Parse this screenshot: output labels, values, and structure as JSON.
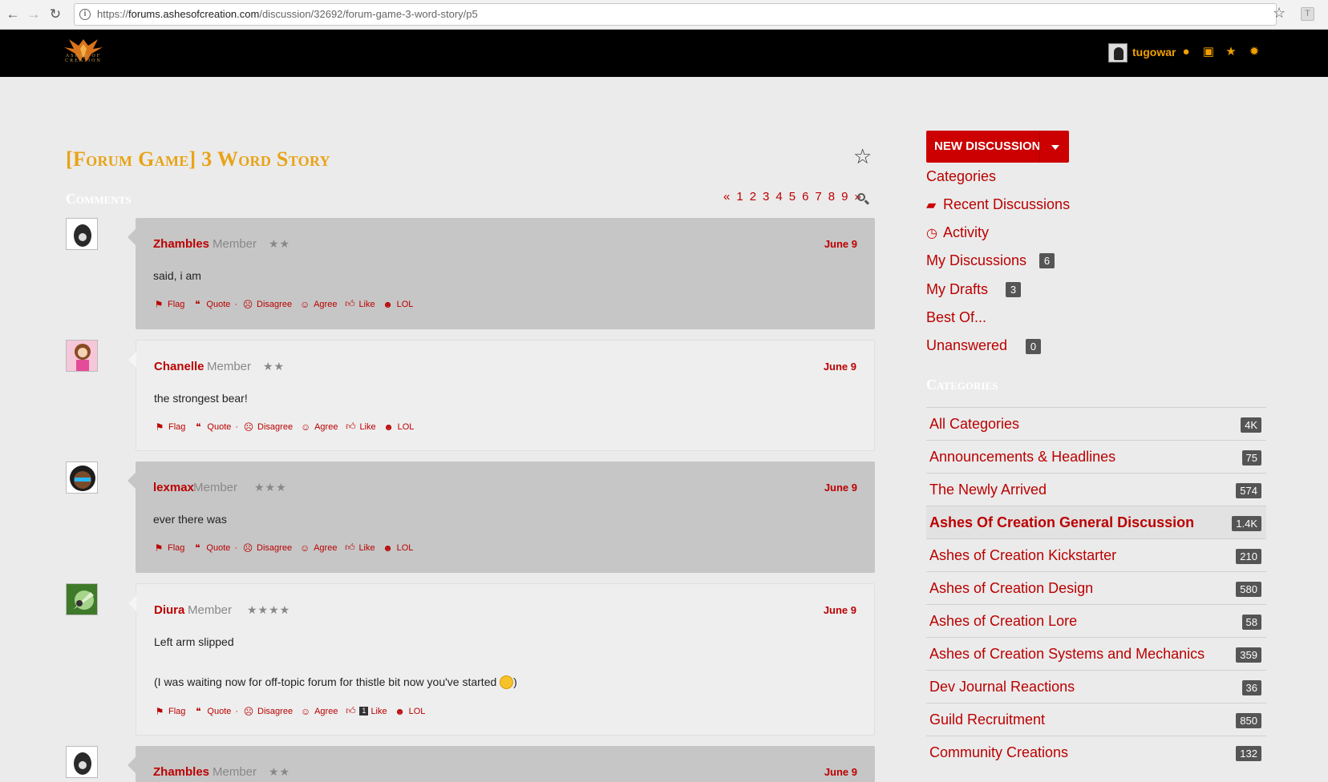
{
  "browser": {
    "url_prefix": "https://",
    "url_host": "forums.ashesofcreation.com",
    "url_path": "/discussion/32692/forum-game-3-word-story/p5"
  },
  "header": {
    "logo_text": "ASHES OF CREATION",
    "username": "tugowar"
  },
  "discussion": {
    "title": "[Forum Game] 3 Word Story",
    "comments_heading": "Comments"
  },
  "pager": [
    "«",
    "1",
    "2",
    "3",
    "4",
    "5",
    "6",
    "7",
    "8",
    "9",
    "»"
  ],
  "reaction_labels": {
    "flag": "Flag",
    "quote": "Quote",
    "disagree": "Disagree",
    "agree": "Agree",
    "like": "Like",
    "lol": "LOL"
  },
  "comments": [
    {
      "author": "Zhambles",
      "role": "Member",
      "stars": "★★",
      "date": "June 9",
      "body": "said, i am"
    },
    {
      "author": "Chanelle",
      "role": "Member",
      "stars": "★★",
      "date": "June 9",
      "body": "the strongest bear!"
    },
    {
      "author": "lexmax",
      "role": "Member",
      "stars": "★★★",
      "date": "June 9",
      "body": "ever there was"
    },
    {
      "author": "Diura",
      "role": "Member",
      "stars": "★★★★",
      "date": "June 9",
      "body": "Left arm slipped",
      "body2": "(I was waiting now for off-topic forum for thistle bit now you've started",
      "body2_end": ")",
      "like_count": "1"
    },
    {
      "author": "Zhambles",
      "role": "Member",
      "stars": "★★",
      "date": "June 9"
    }
  ],
  "sidebar": {
    "new_discussion": "NEW DISCUSSION",
    "links": {
      "categories": "Categories",
      "recent": "Recent Discussions",
      "activity": "Activity",
      "my_discussions": "My Discussions",
      "my_discussions_count": "6",
      "my_drafts": "My Drafts",
      "my_drafts_count": "3",
      "best_of": "Best Of...",
      "unanswered": "Unanswered",
      "unanswered_count": "0"
    },
    "categories_heading": "Categories",
    "categories": [
      {
        "name": "All Categories",
        "count": "4K"
      },
      {
        "name": "Announcements & Headlines",
        "count": "75"
      },
      {
        "name": "The Newly Arrived",
        "count": "574"
      },
      {
        "name": "Ashes Of Creation General Discussion",
        "count": "1.4K"
      },
      {
        "name": "Ashes of Creation Kickstarter",
        "count": "210"
      },
      {
        "name": "Ashes of Creation Design",
        "count": "580"
      },
      {
        "name": "Ashes of Creation Lore",
        "count": "58"
      },
      {
        "name": "Ashes of Creation Systems and Mechanics",
        "count": "359"
      },
      {
        "name": "Dev Journal Reactions",
        "count": "36"
      },
      {
        "name": "Guild Recruitment",
        "count": "850"
      },
      {
        "name": "Community Creations",
        "count": "132"
      }
    ]
  },
  "colors": {
    "accent_red": "#b00000",
    "title_gold": "#e8a317",
    "header_black": "#000000"
  }
}
